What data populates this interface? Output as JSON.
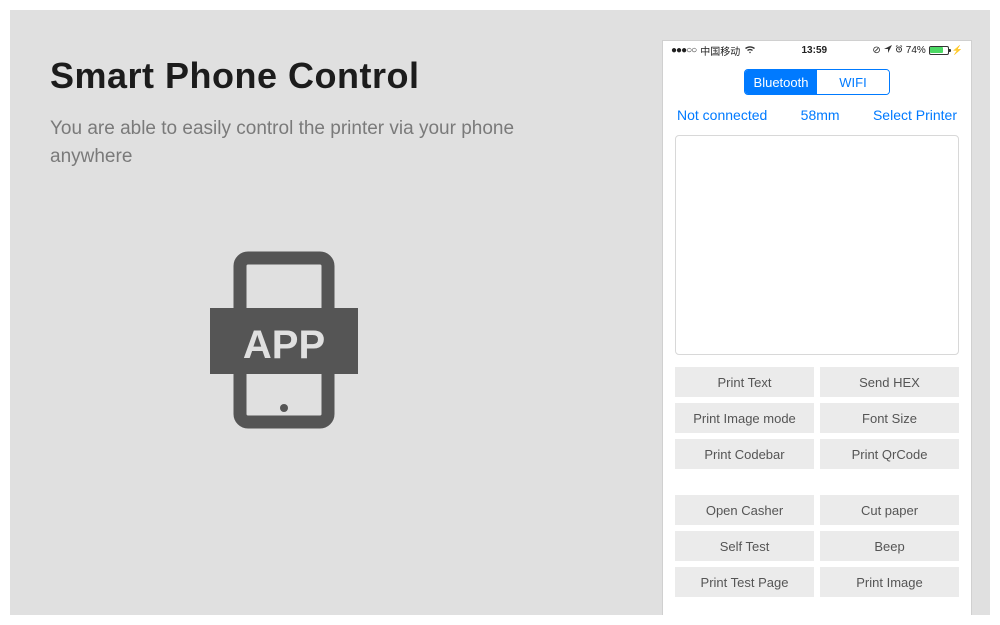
{
  "title": "Smart Phone Control",
  "subtitle": "You are able to easily control the printer via your phone anywhere",
  "status": {
    "carrier": "中国移动",
    "time": "13:59",
    "battery_pct": "74%"
  },
  "segmented": {
    "bluetooth": "Bluetooth",
    "wifi": "WIFI"
  },
  "conn": {
    "status": "Not connected",
    "width": "58mm",
    "select": "Select Printer"
  },
  "buttons_group1": {
    "b0": "Print Text",
    "b1": "Send HEX",
    "b2": "Print Image mode",
    "b3": "Font Size",
    "b4": "Print Codebar",
    "b5": "Print QrCode"
  },
  "buttons_group2": {
    "b0": "Open Casher",
    "b1": "Cut paper",
    "b2": "Self Test",
    "b3": "Beep",
    "b4": "Print Test Page",
    "b5": "Print Image"
  },
  "app_label": "APP"
}
